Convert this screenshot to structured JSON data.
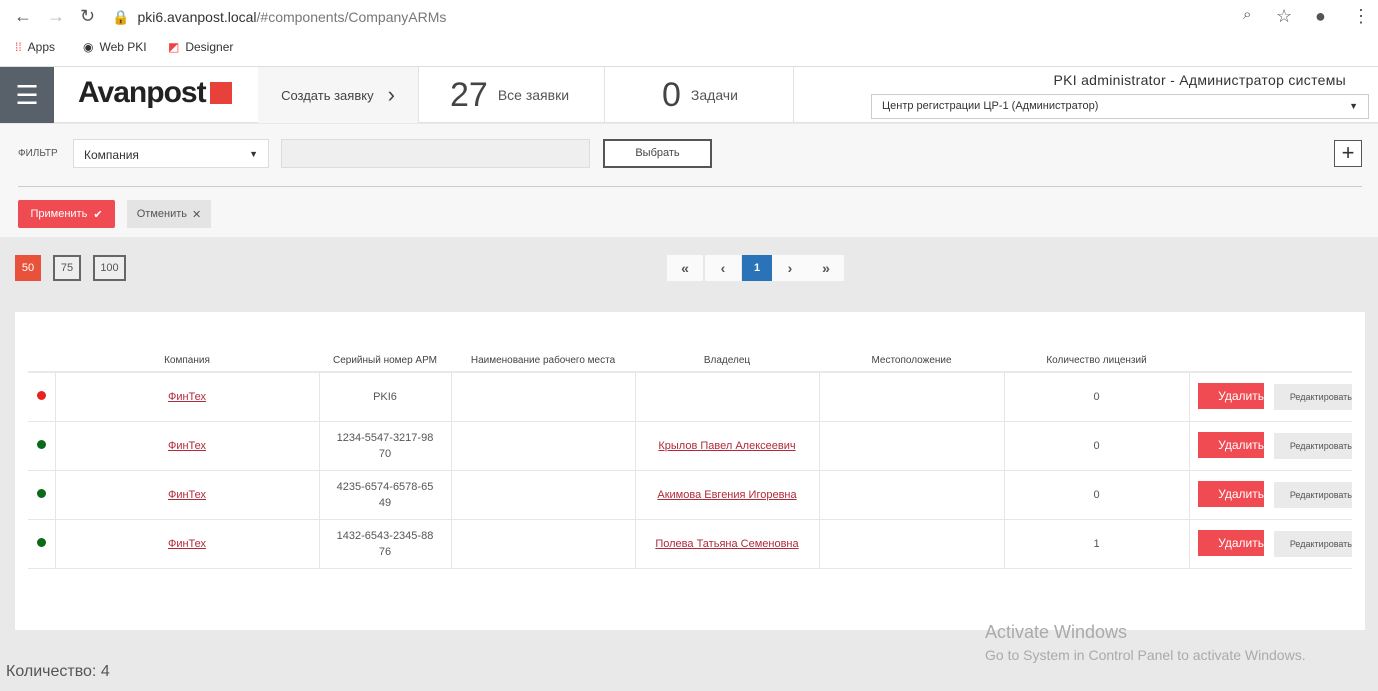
{
  "browser": {
    "url_host": "pki6.avanpost.local",
    "url_path": "/#components/CompanyARMs",
    "bookmarks": [
      "Apps",
      "Web PKI",
      "Designer"
    ]
  },
  "header": {
    "logo": "Avanpost",
    "create": "Создать заявку",
    "all_count": "27",
    "all_label": "Все заявки",
    "tasks_count": "0",
    "tasks_label": "Задачи",
    "user": "PKI administrator - Администратор системы",
    "role": "Центр регистрации ЦР-1 (Администратор)"
  },
  "filter": {
    "label": "ФИЛЬТР",
    "field": "Компания",
    "choose": "Выбрать",
    "apply": "Применить",
    "cancel": "Отменить"
  },
  "pagination": {
    "page_sizes": [
      "50",
      "75",
      "100"
    ],
    "active_size": "50",
    "current_page": "1"
  },
  "table": {
    "headers": [
      "Компания",
      "Серийный номер АРМ",
      "Наименование рабочего места",
      "Владелец",
      "Местоположение",
      "Количество лицензий"
    ],
    "rows": [
      {
        "status": "#e8231c",
        "company": "ФинТех",
        "serial": "PKI6",
        "name": "",
        "owner": "",
        "location": "",
        "licenses": "0"
      },
      {
        "status": "#0b6a1a",
        "company": "ФинТех",
        "serial": "1234-5547-3217-9870",
        "name": "",
        "owner": "Крылов Павел Алексеевич",
        "location": "",
        "licenses": "0"
      },
      {
        "status": "#0b6a1a",
        "company": "ФинТех",
        "serial": "4235-6574-6578-6549",
        "name": "",
        "owner": "Акимова Евгения Игоревна",
        "location": "",
        "licenses": "0"
      },
      {
        "status": "#0b6a1a",
        "company": "ФинТех",
        "serial": "1432-6543-2345-8876",
        "name": "",
        "owner": "Полева Татьяна Семеновна",
        "location": "",
        "licenses": "1"
      }
    ],
    "delete": "Удалить",
    "edit": "Редактировать"
  },
  "footer": {
    "count": "Количество: 4"
  },
  "watermark": {
    "title": "Activate Windows",
    "sub": "Go to System in Control Panel to activate Windows."
  }
}
